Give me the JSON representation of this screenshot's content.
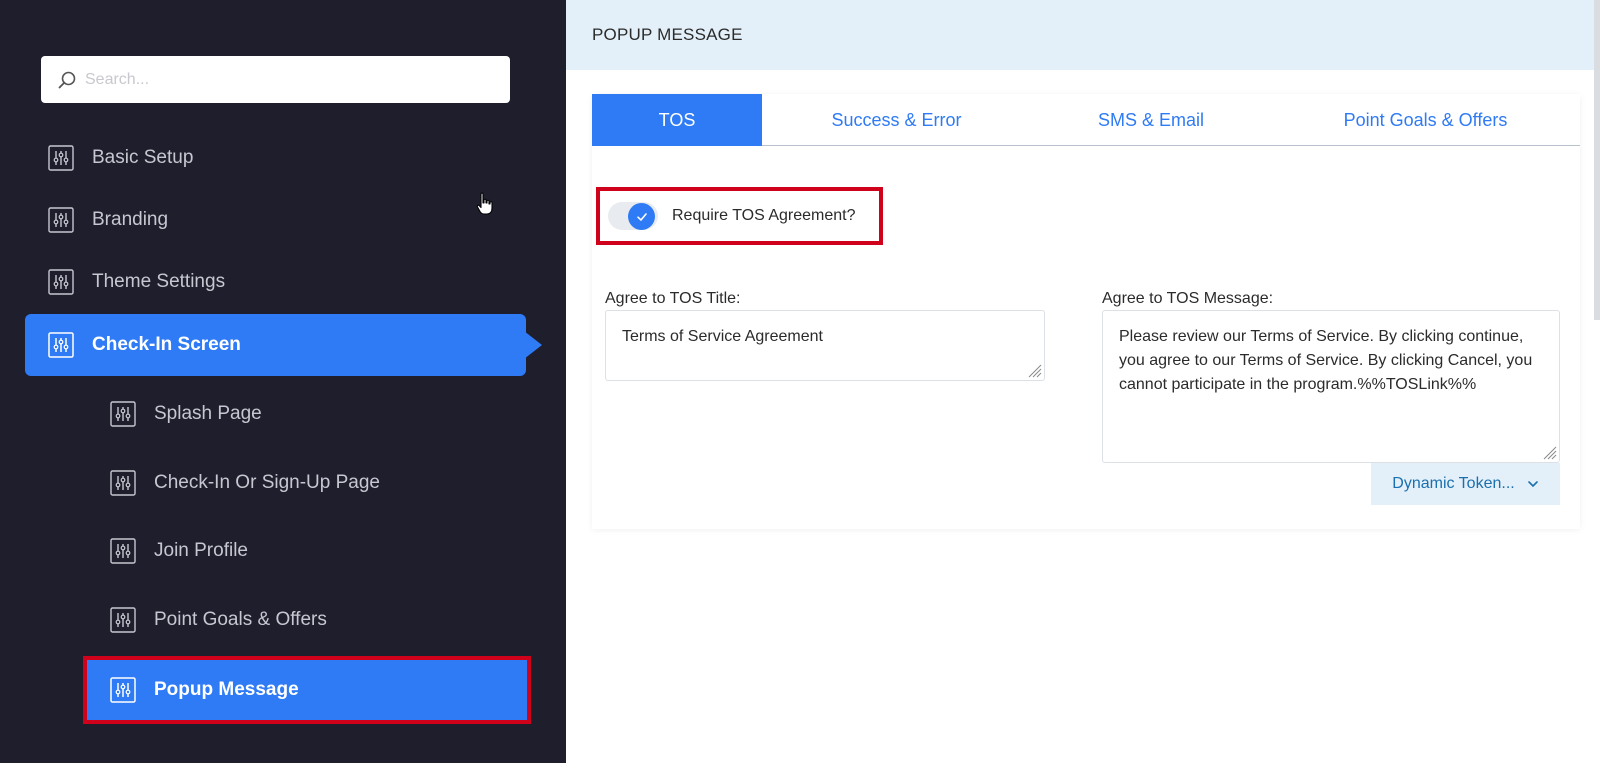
{
  "sidebar": {
    "search_placeholder": "Search...",
    "items": [
      {
        "label": "Basic Setup"
      },
      {
        "label": "Branding"
      },
      {
        "label": "Theme Settings"
      },
      {
        "label": "Check-In Screen"
      }
    ],
    "sub_items": [
      {
        "label": "Splash Page"
      },
      {
        "label": "Check-In Or Sign-Up Page"
      },
      {
        "label": "Join Profile"
      },
      {
        "label": "Point Goals & Offers"
      },
      {
        "label": "Popup Message"
      }
    ]
  },
  "main": {
    "header_title": "POPUP MESSAGE",
    "tabs": [
      {
        "label": "TOS"
      },
      {
        "label": "Success & Error"
      },
      {
        "label": "SMS & Email"
      },
      {
        "label": "Point Goals & Offers"
      }
    ],
    "toggle_label": "Require TOS Agreement?",
    "toggle_on": true,
    "title_label": "Agree to TOS Title:",
    "title_value": "Terms of Service Agreement",
    "message_label": "Agree to TOS Message:",
    "message_value": "Please review our Terms of Service. By clicking continue, you agree to our Terms of Service. By clicking Cancel, you cannot participate in the program.%%TOSLink%%",
    "token_button": "Dynamic Token..."
  },
  "colors": {
    "sidebar_bg": "#1e1e2d",
    "accent": "#2f7bf5",
    "highlight": "#d0021b",
    "header_bg": "#e4f0f9"
  }
}
